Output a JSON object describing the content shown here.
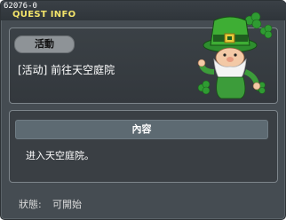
{
  "window": {
    "quest_id": "62076-0",
    "title": "QUEST INFO"
  },
  "quest": {
    "tag": "活動",
    "name": "[活动] 前往天空庭院"
  },
  "content": {
    "header": "內容",
    "text": "进入天空庭院。"
  },
  "status": {
    "label": "狀態:",
    "value": "可開始"
  },
  "npc": {
    "icon": "leprechaun-npc-icon"
  },
  "colors": {
    "window_bg": "#454c52",
    "title": "#f2e36a",
    "tag_bg": "#8e9397",
    "content_bar": "#5d6a72"
  }
}
